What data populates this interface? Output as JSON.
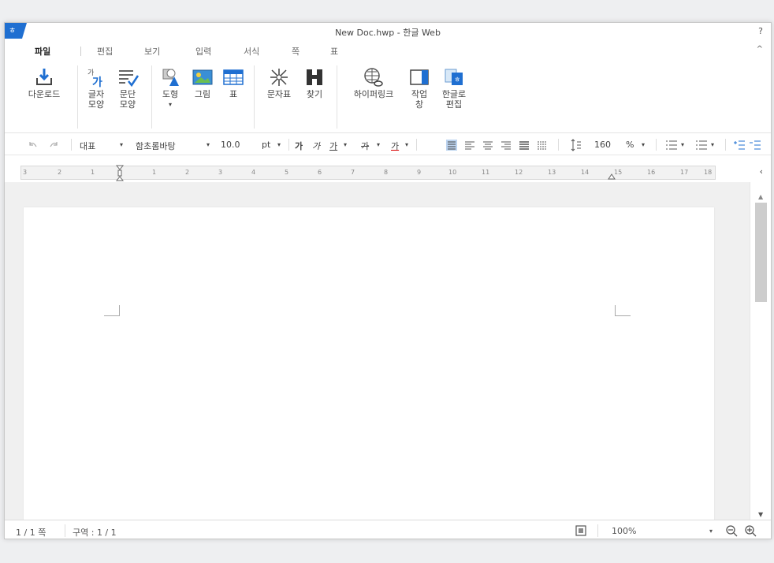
{
  "window": {
    "title": "New Doc.hwp - 한글 Web",
    "help": "?"
  },
  "menu": {
    "items": [
      "파일",
      "편집",
      "보기",
      "입력",
      "서식",
      "쪽",
      "표"
    ],
    "active": "파일",
    "collapse": "^"
  },
  "ribbon": {
    "download": "다운로드",
    "char_shape_1": "글자",
    "char_shape_2": "모양",
    "para_shape_1": "문단",
    "para_shape_2": "모양",
    "shape": "도형",
    "shape_arrow": "▾",
    "image": "그림",
    "table": "표",
    "symbol": "문자표",
    "find": "찾기",
    "hyperlink": "하이퍼링크",
    "task_pane_1": "작업",
    "task_pane_2": "창",
    "hangul_edit_1": "한글로",
    "hangul_edit_2": "편집"
  },
  "format": {
    "style": "대표",
    "font": "함초롬바탕",
    "size": "10.0",
    "unit": "pt",
    "line_spacing": "160",
    "percent": "%"
  },
  "ruler": {
    "labels": [
      "3",
      "2",
      "1",
      "1",
      "2",
      "3",
      "4",
      "5",
      "6",
      "7",
      "8",
      "9",
      "10",
      "11",
      "12",
      "13",
      "14",
      "15",
      "16",
      "17",
      "18"
    ]
  },
  "status": {
    "page": "1 / 1 쪽",
    "section": "구역 : 1 / 1",
    "zoom": "100%"
  },
  "colors": {
    "accent": "#1f6fd1",
    "scroll_thumb": "#cdcdcd"
  }
}
